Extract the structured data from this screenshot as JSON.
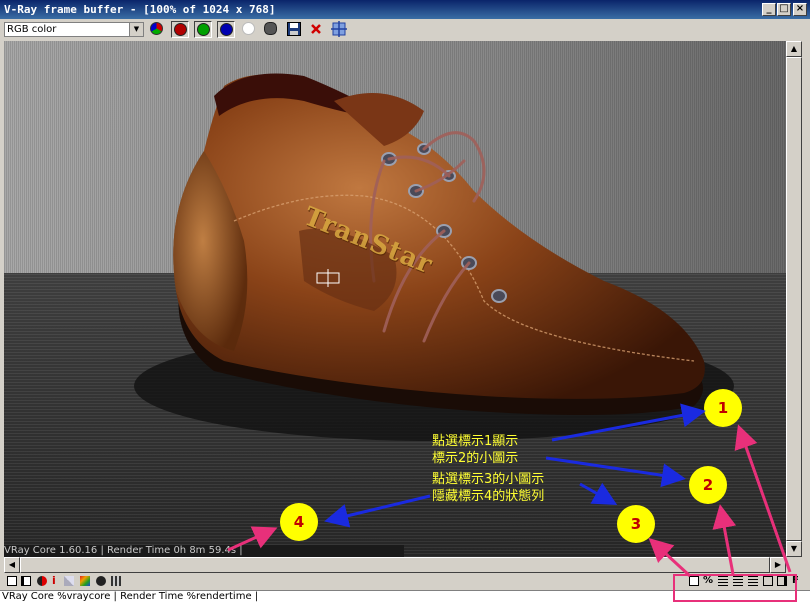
{
  "window": {
    "title": "V-Ray frame buffer - [100% of 1024 x 768]",
    "controls": {
      "minimize": "_",
      "maximize": "□",
      "close": "×"
    }
  },
  "toolbar": {
    "channel_select": {
      "value": "RGB color"
    },
    "buttons": [
      {
        "name": "track-mouse-button",
        "icon": "rgb-circle-icon"
      },
      {
        "name": "red-channel-button",
        "icon": "red-dot-icon",
        "color": "#b00000"
      },
      {
        "name": "green-channel-button",
        "icon": "green-dot-icon",
        "color": "#00a000"
      },
      {
        "name": "blue-channel-button",
        "icon": "blue-dot-icon",
        "color": "#0000b0"
      },
      {
        "name": "alpha-channel-button",
        "icon": "white-dot-icon",
        "color": "#ffffff"
      },
      {
        "name": "monochrome-button",
        "icon": "gray-dot-icon",
        "color": "#555555"
      },
      {
        "name": "save-image-button",
        "icon": "floppy-icon"
      },
      {
        "name": "clear-image-button",
        "icon": "red-x-icon",
        "color": "#d00000"
      },
      {
        "name": "duplicate-vfb-button",
        "icon": "crosshair-grid-icon"
      }
    ]
  },
  "render_overlay_status": "VRay Core 1.60.16 | Render Time 0h 8m 59.4s |",
  "status_bar": "VRay Core %vraycore | Render Time %rendertime |",
  "watermark": "TranStar",
  "annotations": {
    "markers": [
      "1",
      "2",
      "3",
      "4"
    ],
    "lines": [
      "點選標示1顯示",
      "標示2的小圖示",
      "點選標示3的小圖示",
      "隱藏標示4的狀態列"
    ],
    "colors": {
      "marker": "#ffff00",
      "marker_text": "#c00000",
      "text": "#ffff33",
      "blue_arrow": "#1a2ae0",
      "pink_arrow": "#e8307a"
    }
  }
}
